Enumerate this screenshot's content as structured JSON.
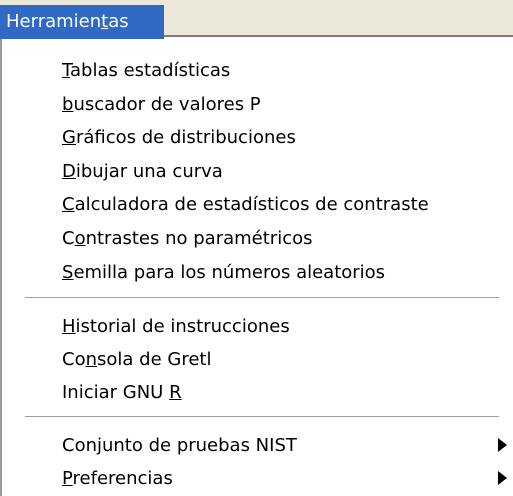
{
  "menubar": {
    "active_menu": {
      "label_before": "Herramien",
      "mnemonic": "t",
      "label_after": "as"
    },
    "colors": {
      "highlight": "#316ac5",
      "bar": "#ece9d8"
    }
  },
  "menu": {
    "items": [
      {
        "before": "",
        "mnemonic": "T",
        "after": "ablas estadísticas",
        "has_submenu": false
      },
      {
        "before": "",
        "mnemonic": "b",
        "after": "uscador de valores P",
        "has_submenu": false
      },
      {
        "before": "",
        "mnemonic": "G",
        "after": "ráficos de distribuciones",
        "has_submenu": false
      },
      {
        "before": "",
        "mnemonic": "D",
        "after": "ibujar una curva",
        "has_submenu": false
      },
      {
        "before": "",
        "mnemonic": "C",
        "after": "alculadora de estadísticos de contraste",
        "has_submenu": false
      },
      {
        "before": "C",
        "mnemonic": "o",
        "after": "ntrastes no paramétricos",
        "has_submenu": false
      },
      {
        "before": "",
        "mnemonic": "S",
        "after": "emilla para los números aleatorios",
        "has_submenu": false
      },
      {
        "before": "",
        "mnemonic": "H",
        "after": "istorial de instrucciones",
        "has_submenu": false
      },
      {
        "before": "Co",
        "mnemonic": "n",
        "after": "sola de Gretl",
        "has_submenu": false
      },
      {
        "before": "Iniciar GNU ",
        "mnemonic": "R",
        "after": "",
        "has_submenu": false
      },
      {
        "before": "Conjunto de pruebas NIST",
        "mnemonic": "",
        "after": "",
        "has_submenu": true
      },
      {
        "before": "",
        "mnemonic": "P",
        "after": "referencias",
        "has_submenu": true
      }
    ]
  }
}
